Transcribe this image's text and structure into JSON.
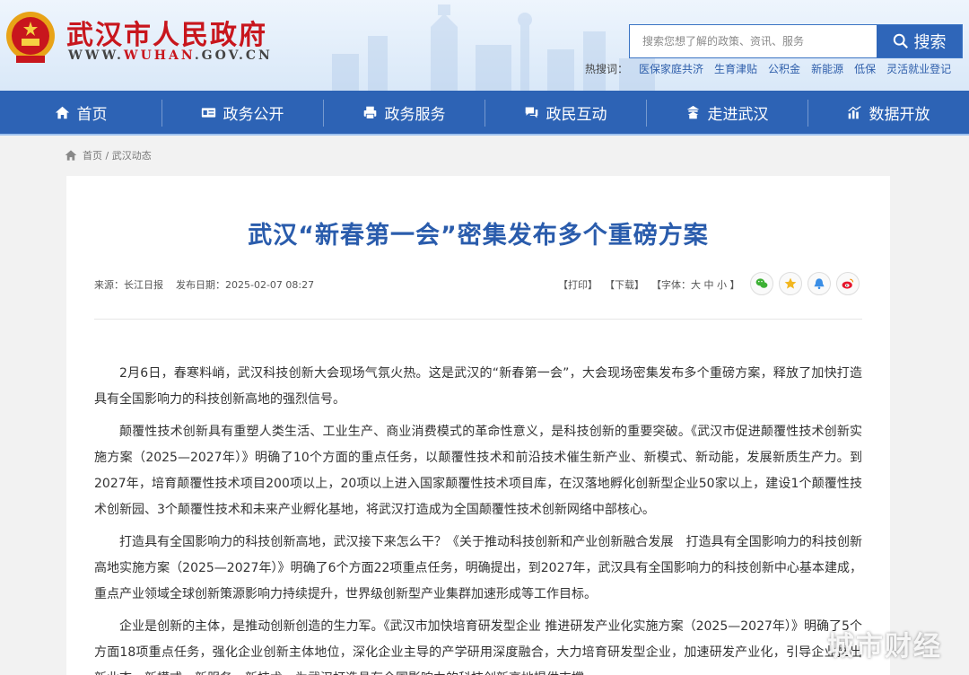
{
  "header": {
    "site_name": "武汉市人民政府",
    "url_prefix": "WWW.",
    "url_highlight": "WUHAN",
    "url_suffix": ".GOV.CN",
    "search_placeholder": "搜索您想了解的政策、资讯、服务",
    "search_button": "搜索",
    "hotwords_label": "热搜词：",
    "hotwords": [
      "医保家庭共济",
      "生育津贴",
      "公积金",
      "新能源",
      "低保",
      "灵活就业登记"
    ]
  },
  "nav": [
    {
      "label": "首页",
      "icon": "home-icon"
    },
    {
      "label": "政务公开",
      "icon": "id-card-icon"
    },
    {
      "label": "政务服务",
      "icon": "printer-icon"
    },
    {
      "label": "政民互动",
      "icon": "chat-icon"
    },
    {
      "label": "走进武汉",
      "icon": "landmark-icon"
    },
    {
      "label": "数据开放",
      "icon": "chart-icon"
    }
  ],
  "breadcrumb": {
    "path": "首页 / 武汉动态"
  },
  "article": {
    "title": "武汉“新春第一会”密集发布多个重磅方案",
    "source": "来源：长江日报",
    "date": "发布日期：2025-02-07 08:27",
    "tools": {
      "print": "【打印】",
      "download": "【下载】",
      "font": "【字体：大 中 小 】"
    },
    "paragraphs": [
      "2月6日，春寒料峭，武汉科技创新大会现场气氛火热。这是武汉的“新春第一会”，大会现场密集发布多个重磅方案，释放了加快打造具有全国影响力的科技创新高地的强烈信号。",
      "颠覆性技术创新具有重塑人类生活、工业生产、商业消费模式的革命性意义，是科技创新的重要突破。《武汉市促进颠覆性技术创新实施方案（2025—2027年）》明确了10个方面的重点任务，以颠覆性技术和前沿技术催生新产业、新模式、新动能，发展新质生产力。到2027年，培育颠覆性技术项目200项以上，20项以上进入国家颠覆性技术项目库，在汉落地孵化创新型企业50家以上，建设1个颠覆性技术创新园、3个颠覆性技术和未来产业孵化基地，将武汉打造成为全国颠覆性技术创新网络中部核心。",
      "打造具有全国影响力的科技创新高地，武汉接下来怎么干？《关于推动科技创新和产业创新融合发展　打造具有全国影响力的科技创新高地实施方案（2025—2027年）》明确了6个方面22项重点任务，明确提出，到2027年，武汉具有全国影响力的科技创新中心基本建成，重点产业领域全球创新策源影响力持续提升，世界级创新型产业集群加速形成等工作目标。",
      "企业是创新的主体，是推动创新创造的生力军。《武汉市加快培育研发型企业 推进研发产业化实施方案（2025—2027年）》明确了5个方面18项重点任务，强化企业创新主体地位，深化企业主导的产学研用深度融合，大力培育研发型企业，加速研发产业化，引导企业推出新业态、新模式、新服务、新技术，为武汉打造具有全国影响力的科技创新高地提供支撑。"
    ]
  },
  "watermark": "城市财经",
  "colors": {
    "brand_red": "#c8161d",
    "nav_blue": "#2d63b5",
    "title_blue": "#2a5cac"
  }
}
